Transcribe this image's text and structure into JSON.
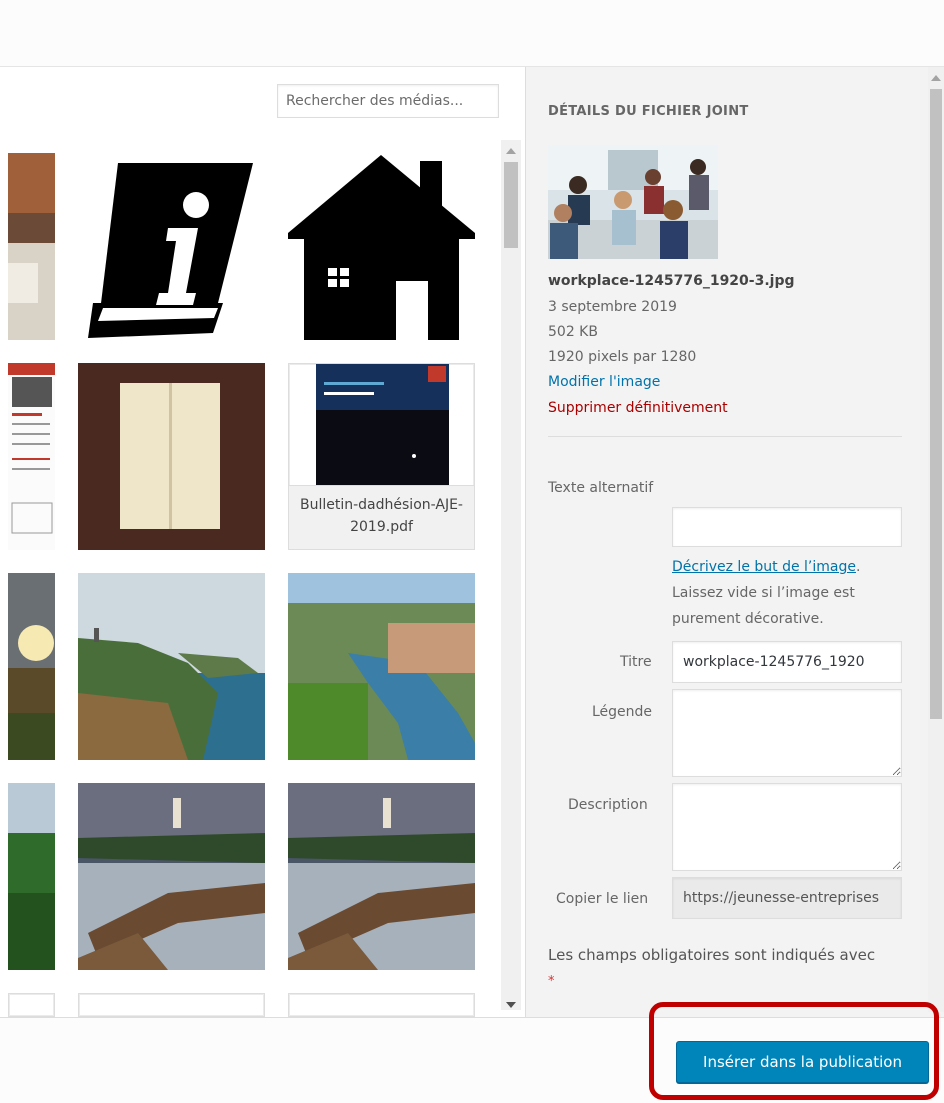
{
  "search": {
    "placeholder": "Rechercher des médias..."
  },
  "grid": {
    "pdf_filename": "Bulletin-dadhésion-AJE-2019.pdf"
  },
  "details": {
    "heading": "DÉTAILS DU FICHIER JOINT",
    "filename": "workplace-1245776_1920-3.jpg",
    "date": "3 septembre 2019",
    "size": "502 KB",
    "dimensions": "1920 pixels par 1280",
    "edit_link": "Modifier l'image",
    "delete_link": "Supprimer définitivement"
  },
  "form": {
    "alt_label": "Texte alternatif",
    "alt_value": "",
    "alt_help_link": "Décrivez le but de l’image",
    "alt_help_text": "Laissez vide si l’image est purement décorative.",
    "title_label": "Titre",
    "title_value": "workplace-1245776_1920",
    "caption_label": "Légende",
    "description_label": "Description",
    "copy_link_label": "Copier le lien",
    "copy_link_value": "https://jeunesse-entreprises",
    "required_note": "Les champs obligatoires sont indiqués avec",
    "required_star": "*"
  },
  "footer": {
    "insert_button": "Insérer dans la publication"
  },
  "colors": {
    "primary": "#0085ba",
    "link": "#0073aa",
    "danger": "#aa0000",
    "highlight": "#c00000"
  }
}
